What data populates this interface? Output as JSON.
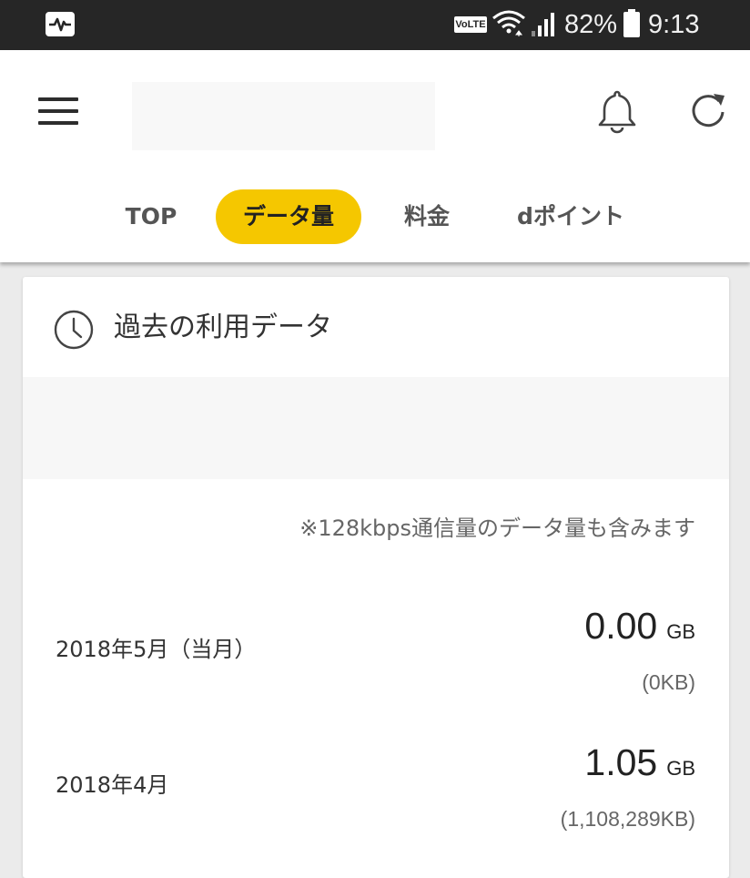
{
  "status_bar": {
    "left_icon": "activity-monitor-icon",
    "network_badge": "VoLTE",
    "battery_percent": "82%",
    "time": "9:13"
  },
  "app_bar": {
    "menu_icon": "hamburger-menu-icon",
    "bell_icon": "bell-icon",
    "refresh_icon": "refresh-icon"
  },
  "tabs": [
    {
      "label": "TOP",
      "active": false
    },
    {
      "label": "データ量",
      "active": true
    },
    {
      "label": "料金",
      "active": false
    },
    {
      "label": "dポイント",
      "active": false
    }
  ],
  "accent_color": "#f5c700",
  "card": {
    "icon": "clock-icon",
    "title": "過去の利用データ",
    "note": "※128kbps通信量のデータ量も含みます",
    "rows": [
      {
        "label": "2018年5月（当月）",
        "value": "0.00",
        "unit": "GB",
        "kb": "(0KB)"
      },
      {
        "label": "2018年4月",
        "value": "1.05",
        "unit": "GB",
        "kb": "(1,108,289KB)"
      }
    ]
  }
}
